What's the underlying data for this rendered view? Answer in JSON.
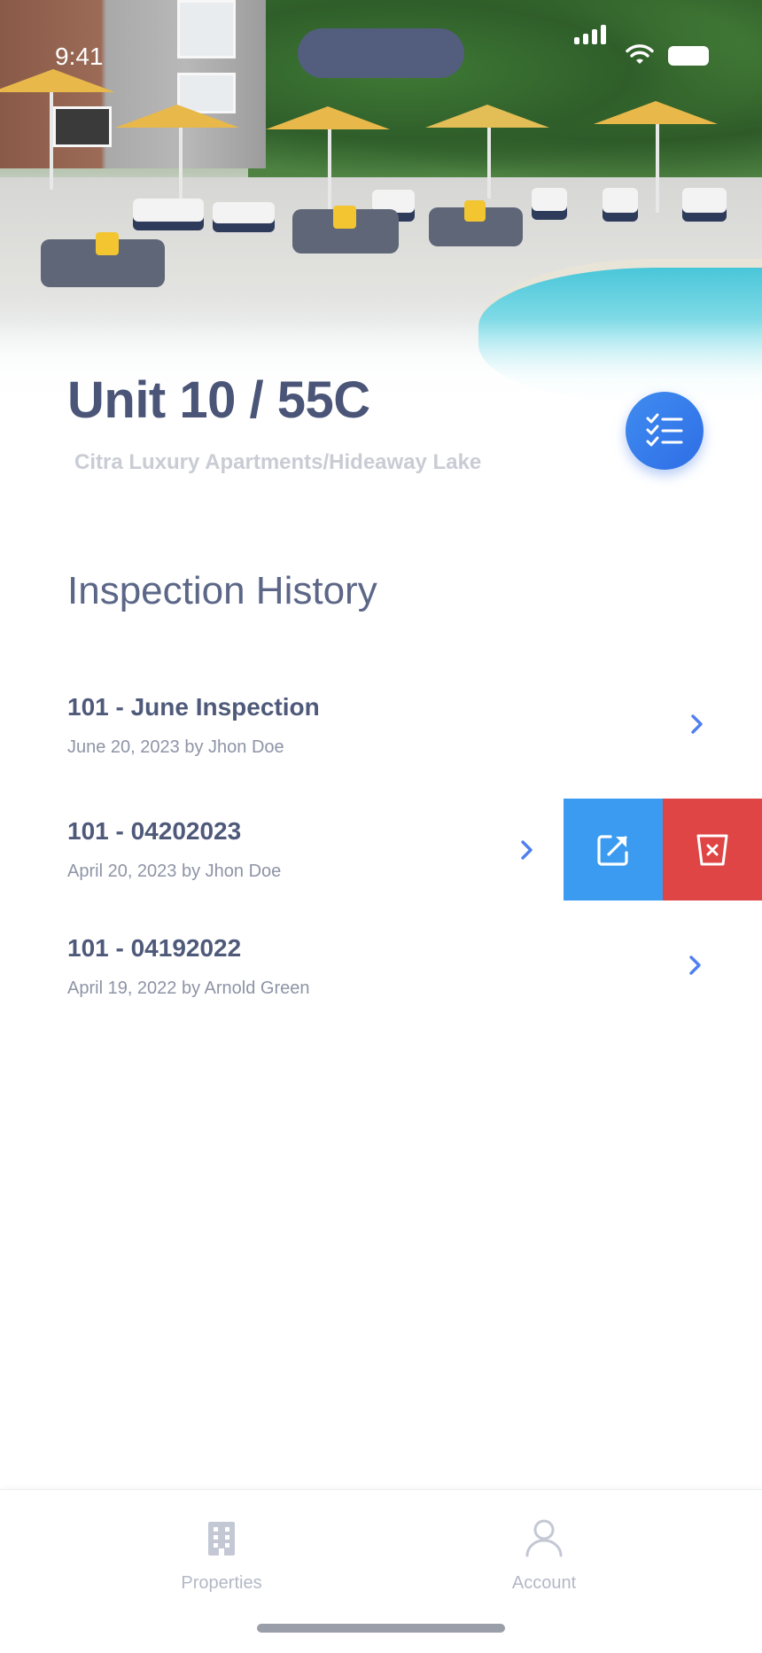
{
  "status_bar": {
    "time": "9:41"
  },
  "header": {
    "unit_title": "Unit 10 / 55C",
    "property_name": "Citra Luxury Apartments/Hideaway Lake",
    "checklist_icon": "checklist-icon"
  },
  "inspection_history": {
    "title": "Inspection History",
    "items": [
      {
        "title": "101 - June Inspection",
        "subtitle": "June 20, 2023 by Jhon Doe"
      },
      {
        "title": "101 - 04202023",
        "subtitle": "April 20, 2023 by Jhon Doe"
      },
      {
        "title": "101 - 04192022",
        "subtitle": "April 19, 2022 by Arnold Green"
      }
    ]
  },
  "swipe_actions": {
    "share_icon": "external-link-icon",
    "delete_icon": "delete-icon"
  },
  "tab_bar": {
    "items": [
      {
        "label": "Properties",
        "icon": "building-icon"
      },
      {
        "label": "Account",
        "icon": "user-icon"
      }
    ]
  },
  "colors": {
    "title": "#4a5578",
    "accent_blue": "#3a9bf0",
    "delete_red": "#df4545",
    "chevron": "#4f7ff0",
    "muted": "#8e94a6"
  }
}
